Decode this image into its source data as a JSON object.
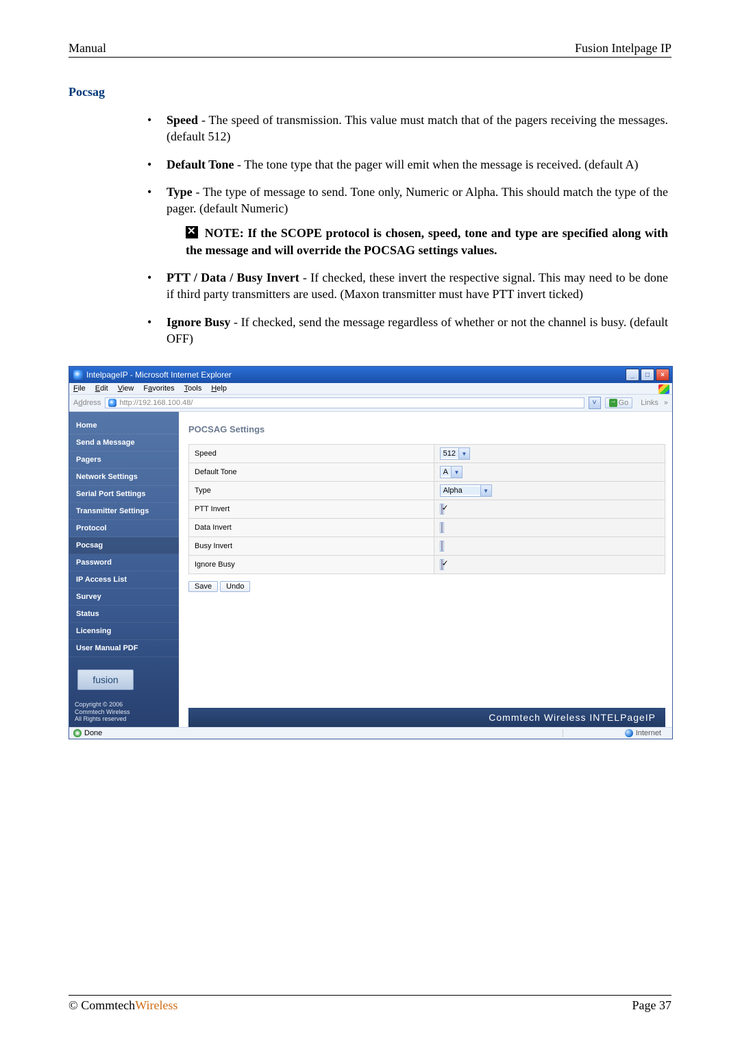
{
  "header": {
    "left": "Manual",
    "right": "Fusion Intelpage IP"
  },
  "section_title": "Pocsag",
  "bullets": {
    "speed": {
      "term": "Speed",
      "text": " - The speed of transmission. This value must match that of the pagers receiving the messages. (default 512)"
    },
    "default_tone": {
      "term": "Default Tone",
      "text": " -  The tone type that the pager will emit when the message is received. (default A)"
    },
    "type": {
      "term": "Type",
      "text": " - The type of message to send. Tone only, Numeric or Alpha. This should match the type of the pager. (default Numeric)"
    },
    "note": " NOTE: If the SCOPE protocol is chosen, speed, tone and type are specified along with the message and will override the POCSAG settings values.",
    "ptt": {
      "term": "PTT / Data / Busy Invert",
      "text": " - If checked, these invert the respective signal. This may need to be done if third party transmitters are used. (Maxon transmitter must have PTT invert ticked)"
    },
    "ignore_busy": {
      "term": "Ignore Busy",
      "text": " - If checked, send the message regardless of whether or not the channel is busy. (default OFF)"
    }
  },
  "ie": {
    "title": "IntelpageIP - Microsoft Internet Explorer",
    "menu": {
      "file": "File",
      "edit": "Edit",
      "view": "View",
      "favorites": "Favorites",
      "tools": "Tools",
      "help": "Help"
    },
    "address_label": "Address",
    "address_value": "http://192.168.100.48/",
    "go": "Go",
    "links": "Links",
    "sidebar": {
      "items": [
        "Home",
        "Send a Message",
        "Pagers",
        "Network Settings",
        "Serial Port Settings",
        "Transmitter Settings",
        "Protocol",
        "Pocsag",
        "Password",
        "IP Access List",
        "Survey",
        "Status",
        "Licensing",
        "User Manual PDF"
      ],
      "fusion": "fusion",
      "copyright": "Copyright © 2006\nCommtech Wireless\nAll Rights reserved"
    },
    "main": {
      "title": "POCSAG Settings",
      "rows": {
        "speed_label": "Speed",
        "speed_val": "512",
        "default_tone_label": "Default Tone",
        "default_tone_val": "A",
        "type_label": "Type",
        "type_val": "Alpha",
        "ptt_label": "PTT Invert",
        "data_label": "Data Invert",
        "busy_label": "Busy Invert",
        "ignore_label": "Ignore Busy"
      },
      "save": "Save",
      "undo": "Undo",
      "brand": "Commtech Wireless INTELPageIP"
    },
    "status": {
      "done": "Done",
      "zone": "Internet"
    }
  },
  "footer": {
    "copyright_symbol": "©",
    "brand1": " Commtech",
    "brand2": "Wireless",
    "page": "Page 37"
  }
}
